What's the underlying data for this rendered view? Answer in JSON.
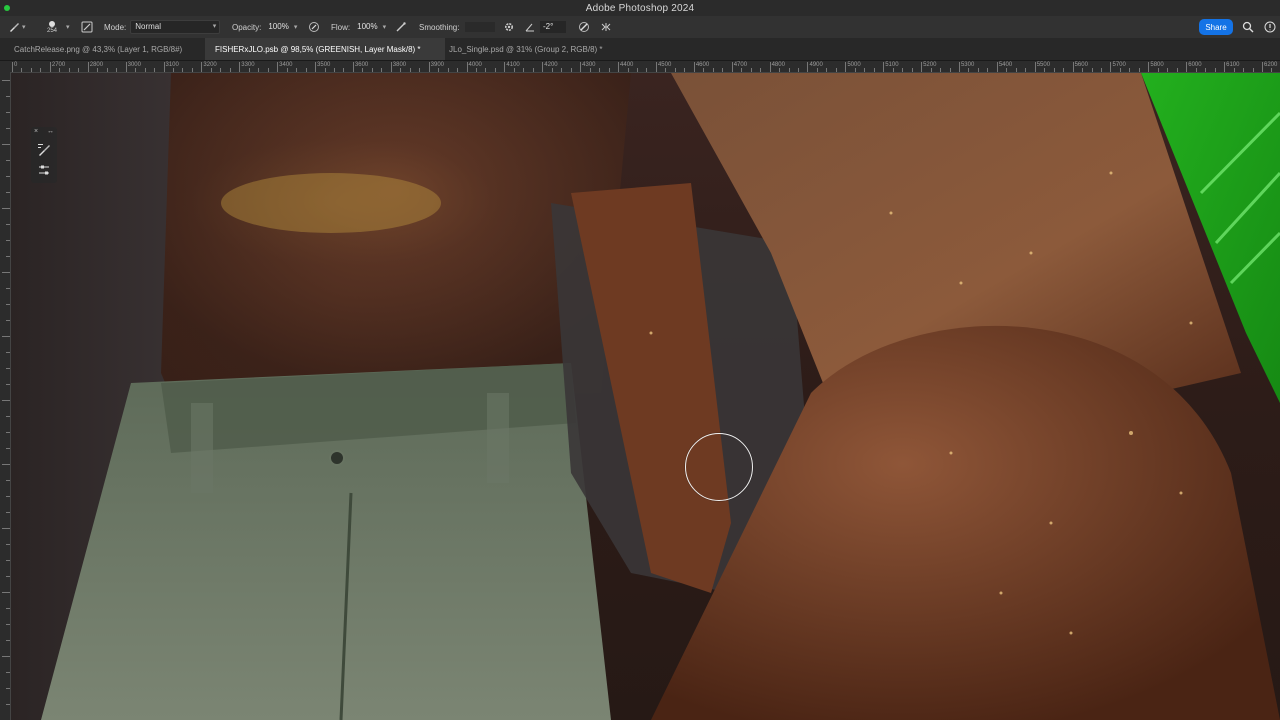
{
  "window": {
    "title": "Adobe Photoshop 2024"
  },
  "options_bar": {
    "brush_size": "254",
    "mode_label": "Mode:",
    "mode_value": "Normal",
    "opacity_label": "Opacity:",
    "opacity_value": "100%",
    "flow_label": "Flow:",
    "flow_value": "100%",
    "smoothing_label": "Smoothing:",
    "angle_value": "-2°",
    "share_label": "Share"
  },
  "tabs": [
    {
      "label": "CatchRelease.png @ 43,3% (Layer 1, RGB/8#)",
      "active": false
    },
    {
      "label": "FISHERxJLO.psb @ 98,5% (GREENISH, Layer Mask/8) *",
      "active": true
    },
    {
      "label": "JLo_Single.psd @ 31% (Group 2, RGB/8) *",
      "active": false
    }
  ],
  "ruler": {
    "labels": [
      "0",
      "2700",
      "2800",
      "3000",
      "3100",
      "3200",
      "3300",
      "3400",
      "3500",
      "3600",
      "3800",
      "3900",
      "4000",
      "4100",
      "4200",
      "4300",
      "4400",
      "4500",
      "4600",
      "4700",
      "4800",
      "4900",
      "5000",
      "5100",
      "5200",
      "5300",
      "5400",
      "5500",
      "5600",
      "5700",
      "5800",
      "6000",
      "6100",
      "6200"
    ]
  },
  "colors": {
    "accent": "#1473e6",
    "green_screen": "#22c41e"
  }
}
